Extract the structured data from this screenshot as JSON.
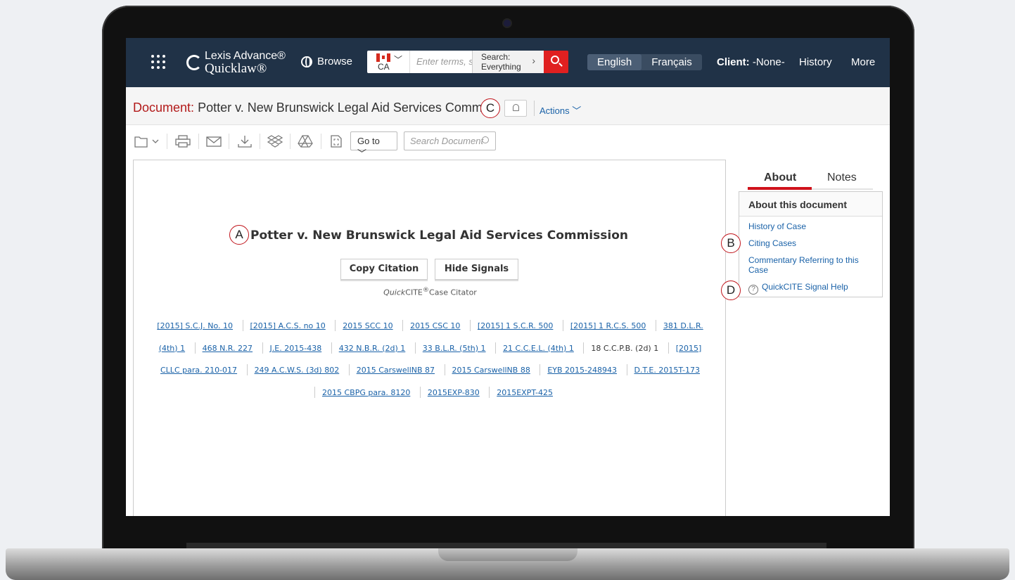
{
  "topbar": {
    "logo_line1": "Lexis Advance®",
    "logo_line2": "Quicklaw®",
    "browse_label": "Browse",
    "country_code": "CA",
    "search_placeholder": "Enter terms, s",
    "search_scope_line1": "Search:",
    "search_scope_line2": "Everything",
    "lang_english": "English",
    "lang_french": "Français",
    "client_label": "Client:",
    "client_value": "-None-",
    "history_label": "History",
    "more_label": "More"
  },
  "doc_header": {
    "label": "Document:",
    "title": "Potter v. New Brunswick Legal Aid Services Commission",
    "actions_label": "Actions"
  },
  "toolbar": {
    "goto_label": "Go to",
    "search_placeholder": "Search Document"
  },
  "document": {
    "case_title": "Potter v. New Brunswick Legal Aid Services Commission",
    "copy_citation": "Copy Citation",
    "hide_signals": "Hide Signals",
    "citator_italic": "Quick",
    "citator_rest": "CITE",
    "citator_reg": "®",
    "citator_suffix": "Case Citator",
    "citations": [
      "[2015] S.C.J. No. 10",
      "[2015] A.C.S. no 10",
      "2015 SCC 10",
      "2015 CSC 10",
      "[2015] 1 S.C.R. 500",
      "[2015] 1 R.C.S. 500",
      "381 D.L.R. (4th) 1",
      "468 N.R. 227",
      "J.E. 2015-438",
      "432 N.B.R. (2d) 1",
      "33 B.L.R. (5th) 1",
      "21 C.C.E.L. (4th) 1",
      "18 C.C.P.B. (2d) 1",
      "[2015] CLLC para. 210-017",
      "249 A.C.W.S. (3d) 802",
      "2015 CarswellNB 87",
      "2015 CarswellNB 88",
      "EYB 2015-248943",
      "D.T.E. 2015T-173",
      "2015 CBPG para. 8120",
      "2015EXP-830",
      "2015EXPT-425"
    ]
  },
  "sidebar": {
    "tab_about": "About",
    "tab_notes": "Notes",
    "box_title": "About this document",
    "links": [
      "History of Case",
      "Citing Cases",
      "Commentary Referring to this Case",
      "QuickCITE Signal Help"
    ]
  },
  "callouts": [
    "A",
    "B",
    "C",
    "D"
  ],
  "colors": {
    "navbar": "#203247",
    "accent_red": "#d0121b",
    "link_blue": "#1a62a8",
    "warning_orange": "#e58a00"
  }
}
